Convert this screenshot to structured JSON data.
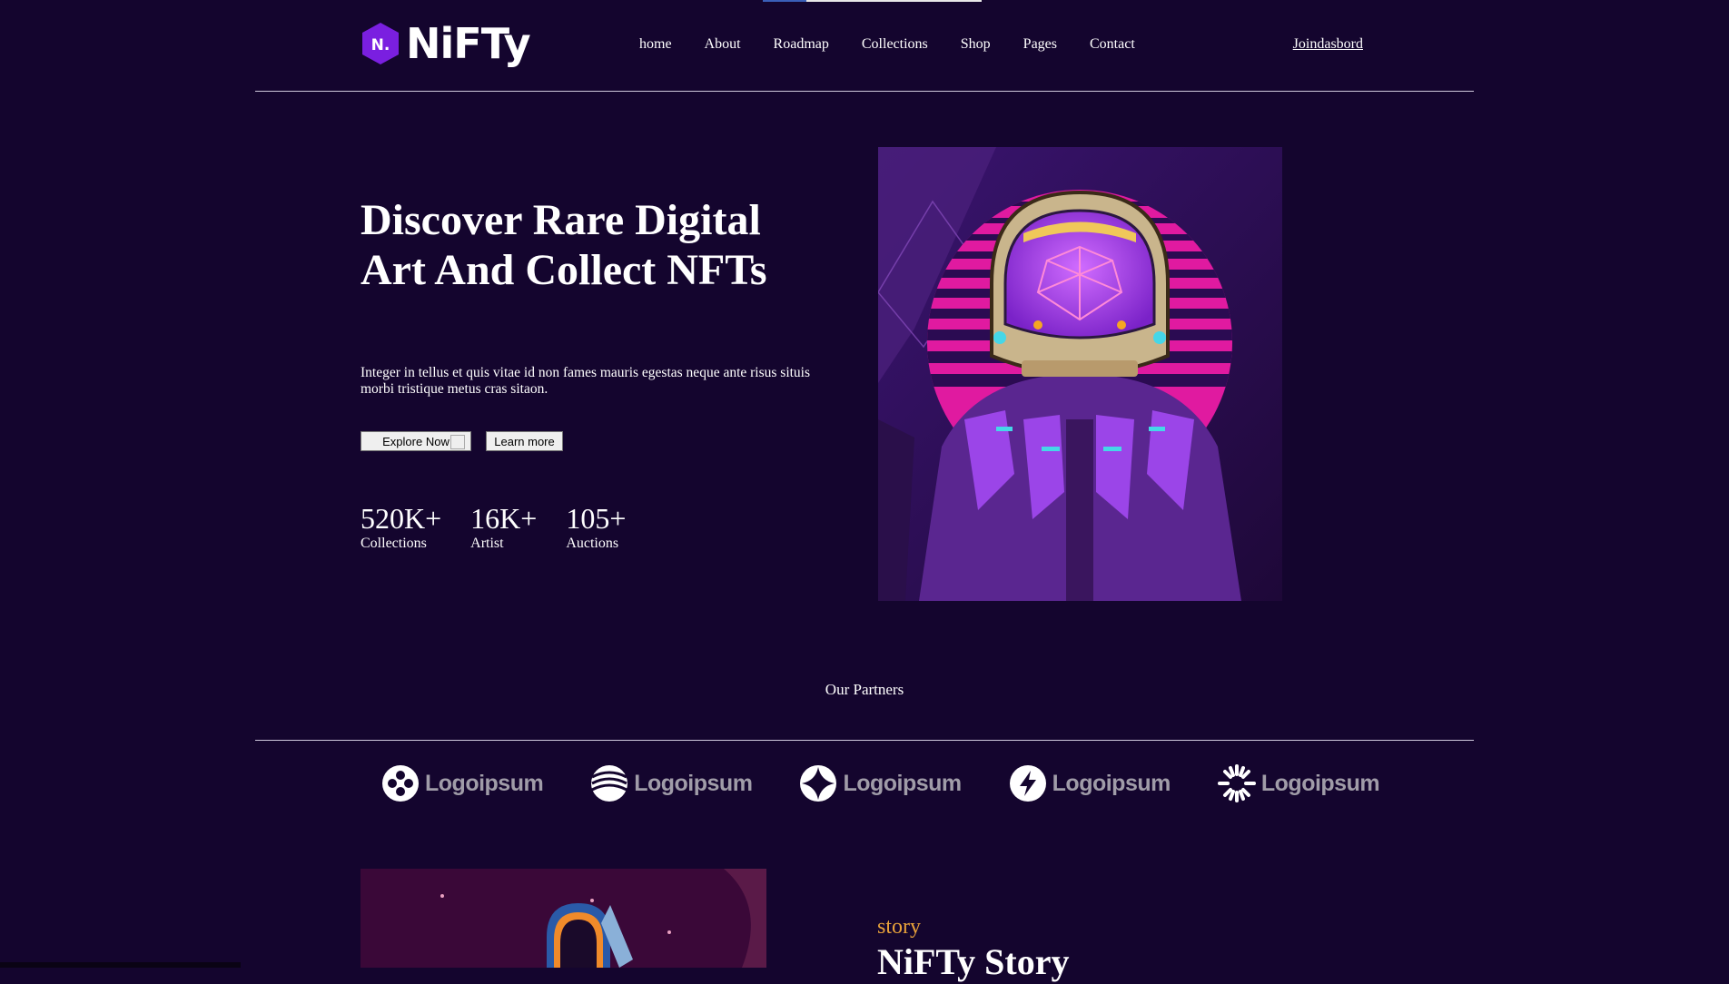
{
  "brand": {
    "logo_letter": "N.",
    "name": "NiFTy",
    "accent": "#7a1fe0"
  },
  "nav": {
    "items": [
      "home",
      "About",
      "Roadmap",
      "Collections",
      "Shop",
      "Pages",
      "Contact"
    ],
    "join_label": "Joindasbord"
  },
  "hero": {
    "title": "Discover Rare Digital Art And Collect NFTs",
    "description": "Integer in tellus et quis vitae id non fames mauris egestas neque ante risus situis morbi tristique metus cras sitaon.",
    "explore_label": "Explore Now",
    "learn_label": "Learn more",
    "stats": [
      {
        "value": "520K+",
        "label": "Collections"
      },
      {
        "value": "16K+",
        "label": "Artist"
      },
      {
        "value": "105+",
        "label": "Auctions"
      }
    ]
  },
  "partners": {
    "title": "Our Partners",
    "items": [
      {
        "name": "Logoipsum",
        "icon": "quad-circle-icon"
      },
      {
        "name": "Logoipsum",
        "icon": "wave-circle-icon"
      },
      {
        "name": "Logoipsum",
        "icon": "star-circle-icon"
      },
      {
        "name": "Logoipsum",
        "icon": "bolt-circle-icon"
      },
      {
        "name": "Logoipsum",
        "icon": "sunburst-icon"
      }
    ]
  },
  "story": {
    "kicker": "story",
    "title": "NiFTy Story"
  },
  "colors": {
    "background": "#14052e",
    "kicker": "#e8a23a",
    "divider": "#cfc9dc"
  }
}
